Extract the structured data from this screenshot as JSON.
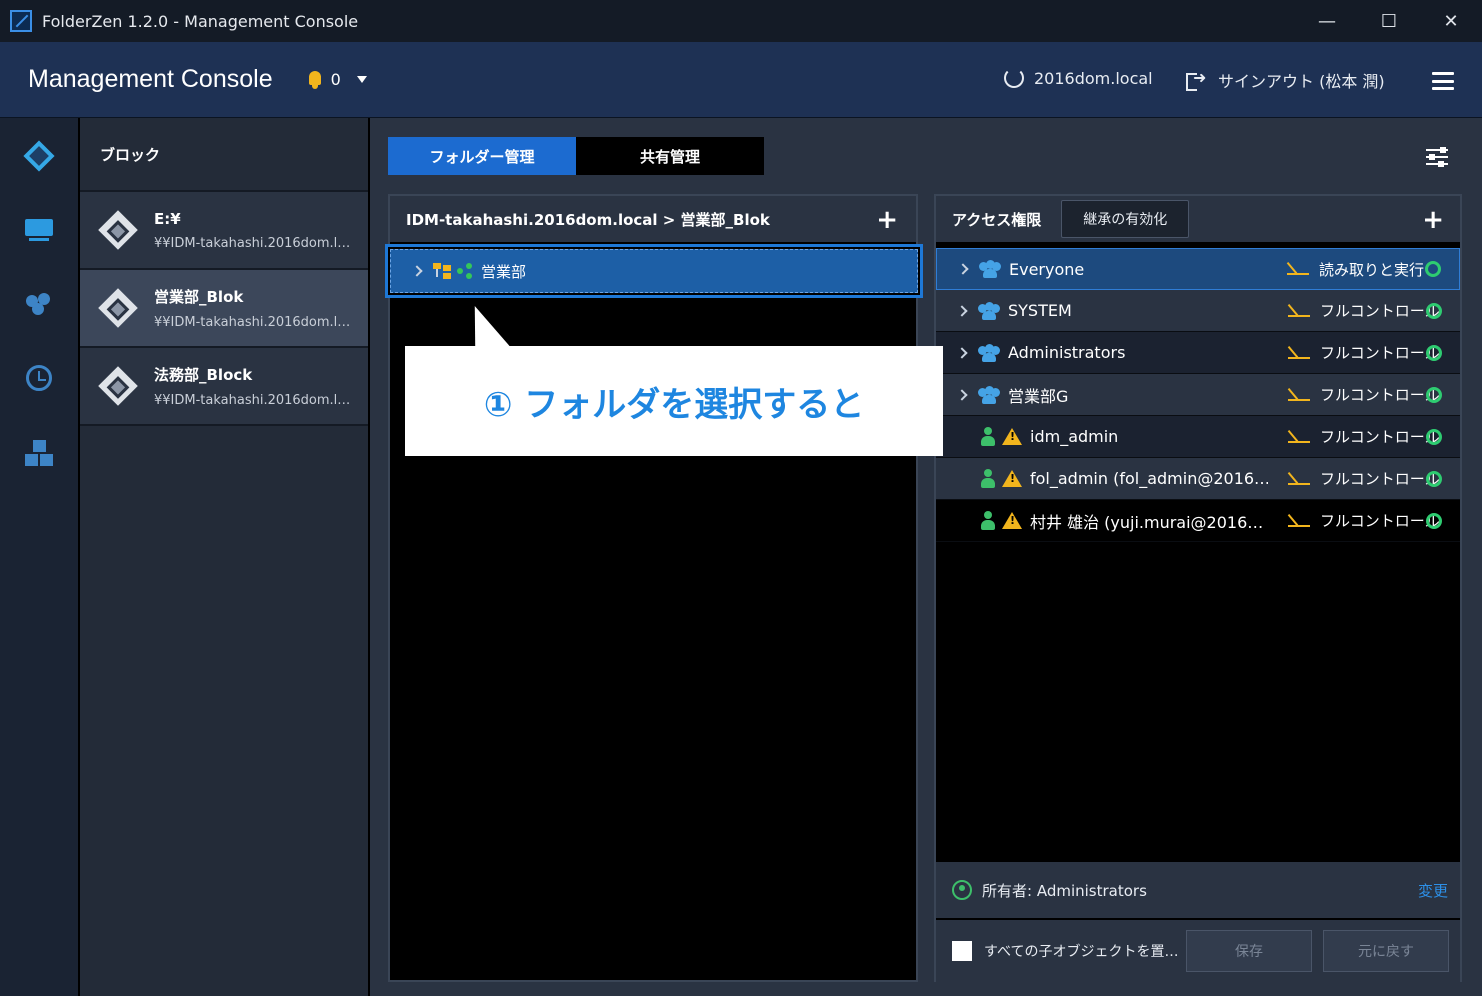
{
  "window": {
    "title": "FolderZen 1.2.0 - Management Console",
    "minimize": "—",
    "maximize": "☐",
    "close": "✕"
  },
  "header": {
    "title": "Management Console",
    "notification_count": "0",
    "domain": "2016dom.local",
    "signout": "サインアウト (松本 潤)"
  },
  "blocks": {
    "heading": "ブロック",
    "items": [
      {
        "name": "E:¥",
        "path": "¥¥IDM-takahashi.2016dom.l…"
      },
      {
        "name": "営業部_Blok",
        "path": "¥¥IDM-takahashi.2016dom.l…"
      },
      {
        "name": "法務部_Block",
        "path": "¥¥IDM-takahashi.2016dom.l…"
      }
    ]
  },
  "tabs": [
    {
      "label": "フォルダー管理"
    },
    {
      "label": "共有管理"
    }
  ],
  "folder_panel": {
    "breadcrumb": "IDM-takahashi.2016dom.local > 営業部_Blok",
    "add": "+",
    "selected_folder": "営業部"
  },
  "callout": {
    "text": "① フォルダを選択すると"
  },
  "access_panel": {
    "title": "アクセス権限",
    "inherit_button": "継承の有効化",
    "add": "+",
    "entries": [
      {
        "name": "Everyone",
        "permission": "読み取りと実行"
      },
      {
        "name": "SYSTEM",
        "permission": "フルコントロール"
      },
      {
        "name": "Administrators",
        "permission": "フルコントロール"
      },
      {
        "name": "営業部G",
        "permission": "フルコントロール"
      },
      {
        "name": "idm_admin",
        "permission": "フルコントロール"
      },
      {
        "name": "fol_admin (fol_admin@2016…",
        "permission": "フルコントロール"
      },
      {
        "name": "村井 雄治 (yuji.murai@2016…",
        "permission": "フルコントロール"
      }
    ],
    "owner": "所有者: Administrators",
    "change": "変更",
    "replace_children": "すべての子オブジェクトを置…",
    "save": "保存",
    "revert": "元に戻す"
  },
  "colors": {
    "accent": "#1c6bd0",
    "header_bg": "#1e3154",
    "callout_text": "#1e86e0",
    "status_ok": "#2ecc71",
    "warning": "#f2b51d"
  }
}
